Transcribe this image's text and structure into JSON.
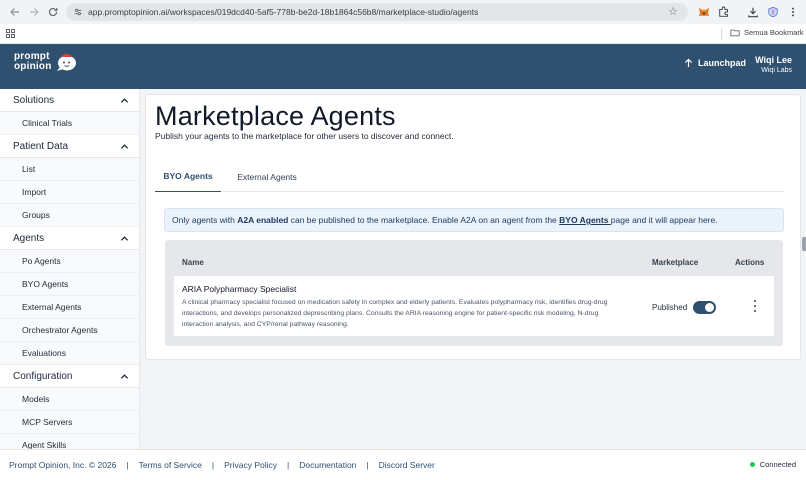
{
  "browser": {
    "url": "app.promptopinion.ai/workspaces/019dcd40-5af5-778b-be2d-18b1864c56b8/marketplace-studio/agents",
    "bookmark_folder": "Semua Bookmark"
  },
  "header": {
    "logo_line1": "prompt",
    "logo_line2": "opinion",
    "launchpad_label": "Launchpad",
    "user_name": "Wiqi Lee",
    "user_org": "Wiqi Labs"
  },
  "sidebar": {
    "sections": [
      {
        "title": "Solutions",
        "items": [
          "Clinical Trials"
        ]
      },
      {
        "title": "Patient Data",
        "items": [
          "List",
          "Import",
          "Groups"
        ]
      },
      {
        "title": "Agents",
        "items": [
          "Po Agents",
          "BYO Agents",
          "External Agents",
          "Orchestrator Agents",
          "Evaluations"
        ]
      },
      {
        "title": "Configuration",
        "items": [
          "Models",
          "MCP Servers",
          "Agent Skills"
        ]
      }
    ]
  },
  "main": {
    "title": "Marketplace Agents",
    "subtitle": "Publish your agents to the marketplace for other users to discover and connect.",
    "tabs": [
      "BYO Agents",
      "External Agents"
    ],
    "active_tab": 0,
    "info": {
      "prefix": "Only agents with ",
      "bold": "A2A enabled",
      "middle": " can be published to the marketplace. Enable A2A on an agent from the ",
      "link": "BYO Agents ",
      "suffix": "page and it will appear here."
    },
    "table": {
      "headers": {
        "name": "Name",
        "marketplace": "Marketplace",
        "actions": "Actions"
      },
      "rows": [
        {
          "name": "ARIA Polypharmacy Specialist",
          "description": "A clinical pharmacy specialist focused on medication safety in complex and elderly patients. Evaluates polypharmacy risk, identifies drug-drug interactions, and develops personalized deprescribing plans. Consults the ARIA reasoning engine for patient-specific risk modeling, N-drug interaction analysis, and CYP/renal pathway reasoning.",
          "status": "Published",
          "published": true
        }
      ]
    }
  },
  "footer": {
    "links": [
      "Prompt Opinion, Inc. © 2026",
      "Terms of Service",
      "Privacy Policy",
      "Documentation",
      "Discord Server"
    ],
    "status": "Connected"
  },
  "colors": {
    "brand": "#2f506f",
    "status_ok": "#22c55e",
    "info_bg": "#eaf2fb"
  }
}
